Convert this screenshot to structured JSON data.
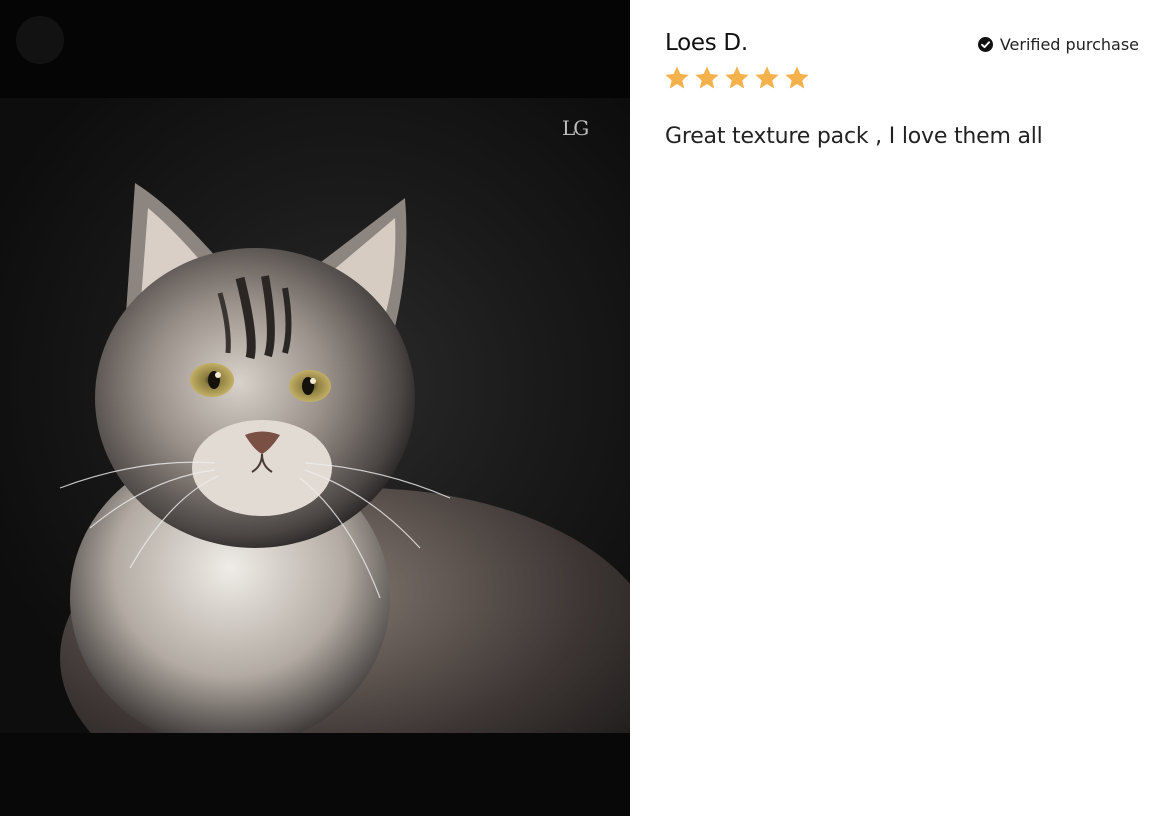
{
  "review": {
    "reviewer_name": "Loes D.",
    "verified_label": "Verified purchase",
    "rating": 5,
    "rating_max": 5,
    "body": "Great texture pack , I love them all"
  },
  "media": {
    "watermark": "LG"
  },
  "colors": {
    "star": "#F5B14C",
    "media_background": "#070707",
    "text": "#222222"
  },
  "icons": {
    "verified": "check-circle-icon",
    "rating": "star-icon",
    "close": "close-icon"
  }
}
